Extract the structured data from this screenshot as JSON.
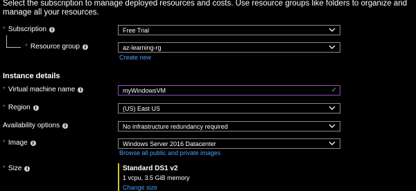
{
  "intro_text": "Select the subscription to manage deployed resources and costs. Use resource groups like folders to organize and manage all your resources.",
  "subscription": {
    "label": "Subscription",
    "value": "Free Trial"
  },
  "resource_group": {
    "label": "Resource group",
    "value": "az-learning-rg",
    "create_new": "Create new"
  },
  "instance_details": {
    "heading": "Instance details"
  },
  "vm_name": {
    "label": "Virtual machine name",
    "value": "myWindowsVM"
  },
  "region": {
    "label": "Region",
    "value": "(US) East US"
  },
  "availability": {
    "label": "Availability options",
    "value": "No infrastructure redundancy required"
  },
  "image": {
    "label": "Image",
    "value": "Windows Server 2016 Datacenter",
    "browse": "Browse all public and private images"
  },
  "size": {
    "label": "Size",
    "name": "Standard DS1 v2",
    "spec": "1 vcpu, 3.5 GiB memory",
    "change": "Change size"
  },
  "colors": {
    "background": "#000000",
    "required": "#e24b4b",
    "link": "#4a9eff",
    "focus_border": "#8c4fb8",
    "valid_check": "#5fbf3f",
    "size_accent": "#d8c23a"
  },
  "icons": {
    "info": "info-icon",
    "dropdown": "chevron-down-icon",
    "valid": "checkmark-icon"
  }
}
